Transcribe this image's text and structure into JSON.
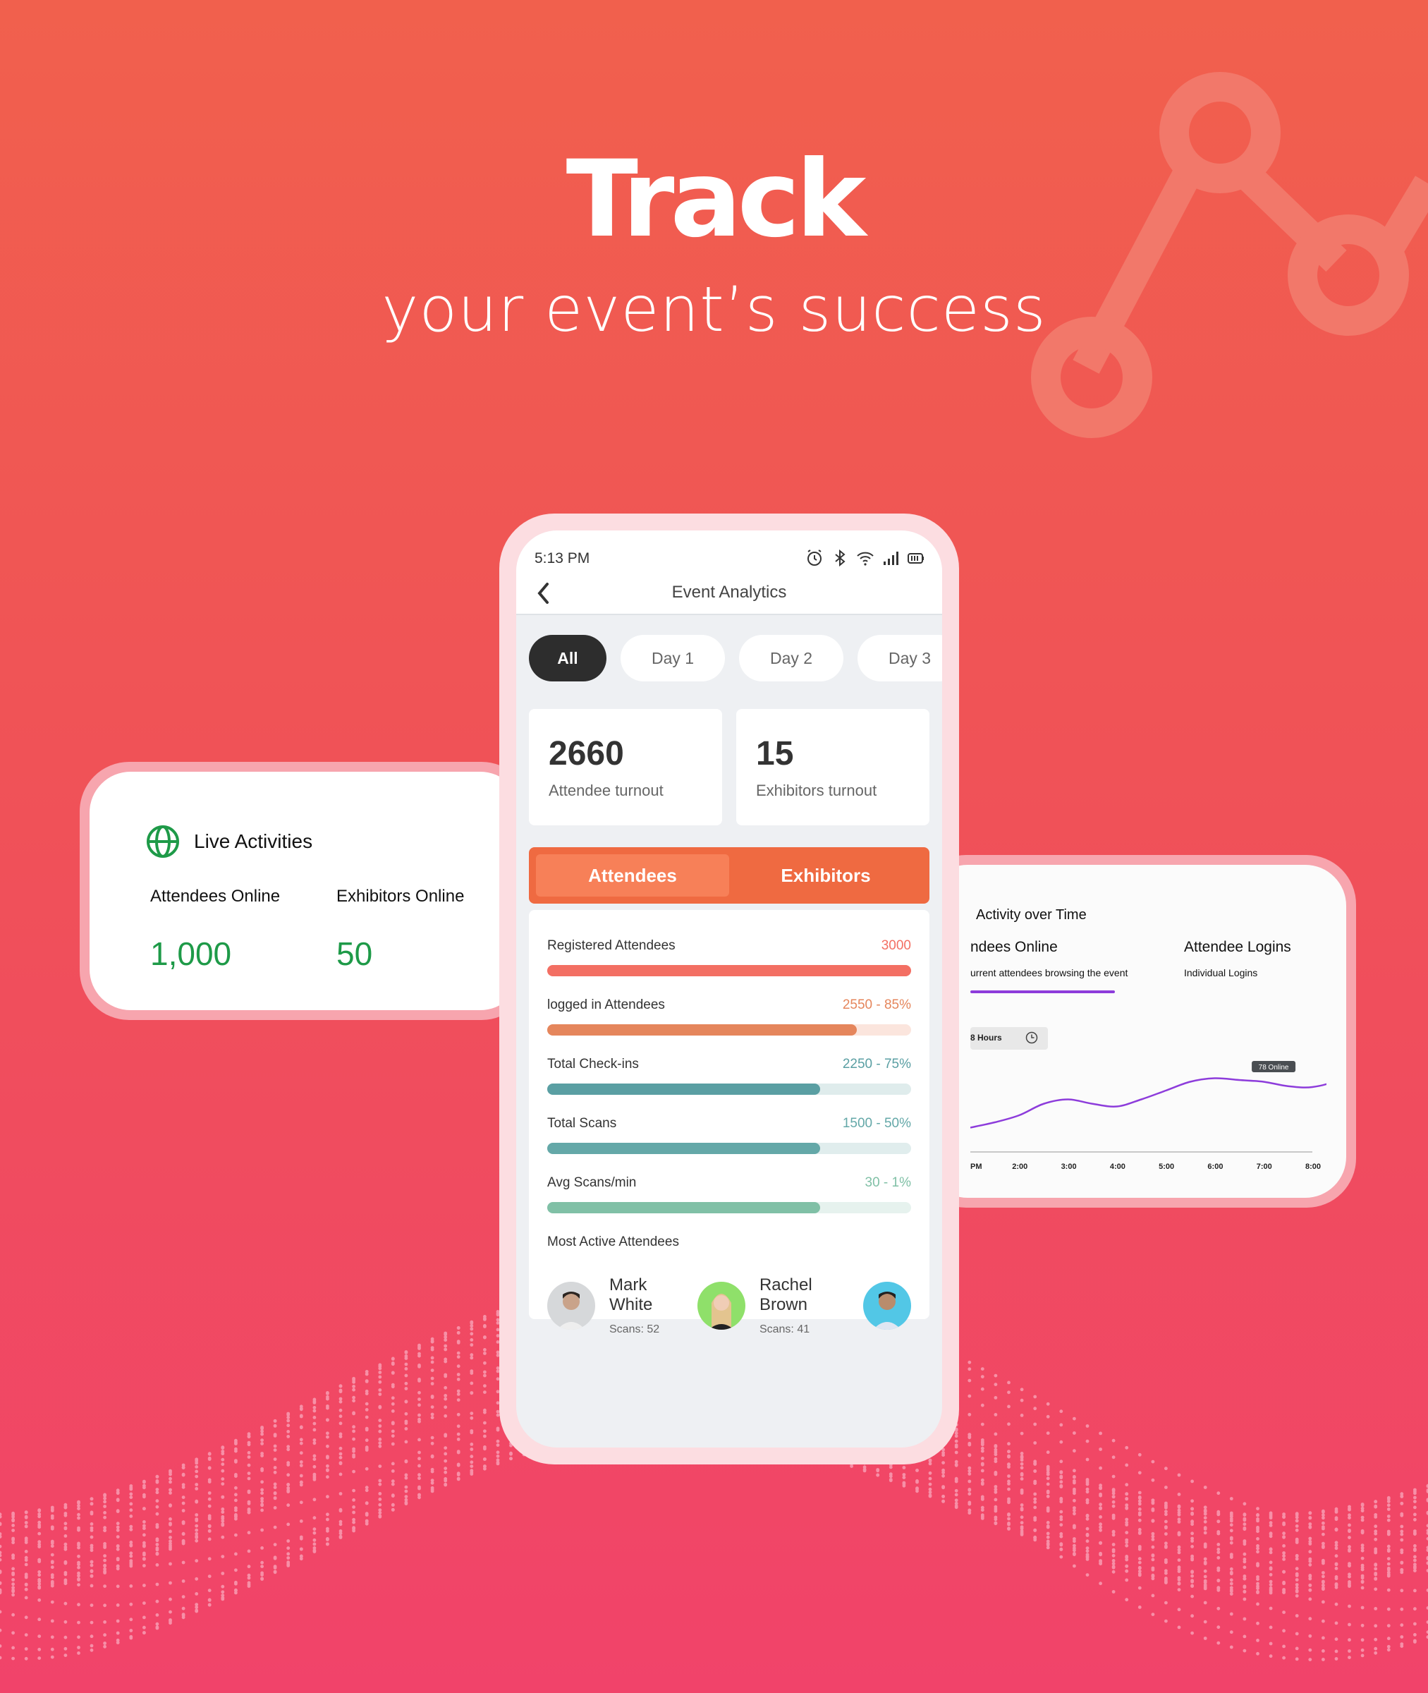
{
  "hero": {
    "title": "Track",
    "subtitle": "your event’s success"
  },
  "live_activities": {
    "title": "Live Activities",
    "icon": "globe-icon",
    "accent_color": "#1e9a48",
    "stats": [
      {
        "label": "Attendees Online",
        "value": "1,000"
      },
      {
        "label": "Exhibitors Online",
        "value": "50"
      }
    ]
  },
  "phone": {
    "status_bar": {
      "time": "5:13 PM",
      "icons": [
        "alarm-icon",
        "bluetooth-icon",
        "wifi-icon",
        "signal-icon",
        "battery-icon"
      ]
    },
    "app_bar": {
      "back_icon": "chevron-left-icon",
      "title": "Event Analytics"
    },
    "day_filters": [
      {
        "label": "All",
        "active": true
      },
      {
        "label": "Day 1",
        "active": false
      },
      {
        "label": "Day 2",
        "active": false
      },
      {
        "label": "Day 3",
        "active": false
      }
    ],
    "turnout": [
      {
        "value": "2660",
        "label": "Attendee turnout"
      },
      {
        "value": "15",
        "label": "Exhibitors turnout"
      }
    ],
    "segment": {
      "options": [
        "Attendees",
        "Exhibitors"
      ],
      "active_index": 0,
      "color": "#ef6a41"
    },
    "metrics": [
      {
        "label": "Registered Attendees",
        "value": "3000",
        "progress": 1.0,
        "color": "#f36f63",
        "track": "#fde0dd"
      },
      {
        "label": "logged in Attendees",
        "value": "2550 - 85%",
        "progress": 0.85,
        "color": "#e5865c",
        "track": "#fbe5dd"
      },
      {
        "label": "Total Check-ins",
        "value": "2250 - 75%",
        "progress": 0.75,
        "color": "#5a9fa3",
        "track": "#dfecec"
      },
      {
        "label": "Total Scans",
        "value": "1500 - 50%",
        "progress": 0.75,
        "color": "#64a8a8",
        "track": "#e0eded"
      },
      {
        "label": "Avg Scans/min",
        "value": "30 - 1%",
        "progress": 0.75,
        "color": "#80c0a6",
        "track": "#e6f2ee"
      }
    ],
    "most_active": {
      "title": "Most Active Attendees",
      "people": [
        {
          "name": "Mark White",
          "scans": "Scans: 52",
          "avatar_bg": "#d6d8da"
        },
        {
          "name": "Rachel Brown",
          "scans": "Scans: 41",
          "avatar_bg": "#8fe06a"
        },
        {
          "name": "",
          "scans": "",
          "avatar_bg": "#52c7e6"
        }
      ]
    }
  },
  "activity_over_time": {
    "title": "Activity over Time",
    "tabs": [
      {
        "title": "ndees Online",
        "subtitle": "urrent attendees browsing the event",
        "active": true
      },
      {
        "title": "Attendee Logins",
        "subtitle": "Individual Logins",
        "active": false
      }
    ],
    "range_label": "8 Hours",
    "range_icon": "clock-icon",
    "line_color": "#8d3cdb",
    "tooltip": "78 Online"
  },
  "chart_data": {
    "type": "line",
    "title": "Activity over Time",
    "xlabel": "",
    "ylabel": "",
    "categories": [
      "PM",
      "2:00",
      "3:00",
      "4:00",
      "5:00",
      "6:00",
      "7:00",
      "8:00"
    ],
    "series": [
      {
        "name": "Attendees Online",
        "x": [
          0,
          0.5,
          1,
          1.5,
          2,
          2.5,
          3,
          3.5,
          4,
          4.5,
          5,
          5.5,
          6,
          6.5,
          7,
          7.5,
          7.9
        ],
        "values": [
          18,
          24,
          32,
          45,
          50,
          45,
          42,
          50,
          60,
          70,
          74,
          72,
          70,
          65,
          64,
          72,
          90
        ]
      }
    ],
    "ylim": [
      0,
      100
    ],
    "annotations": [
      {
        "x": 5.5,
        "text": "78 Online"
      }
    ],
    "grid": false,
    "legend": "none"
  }
}
